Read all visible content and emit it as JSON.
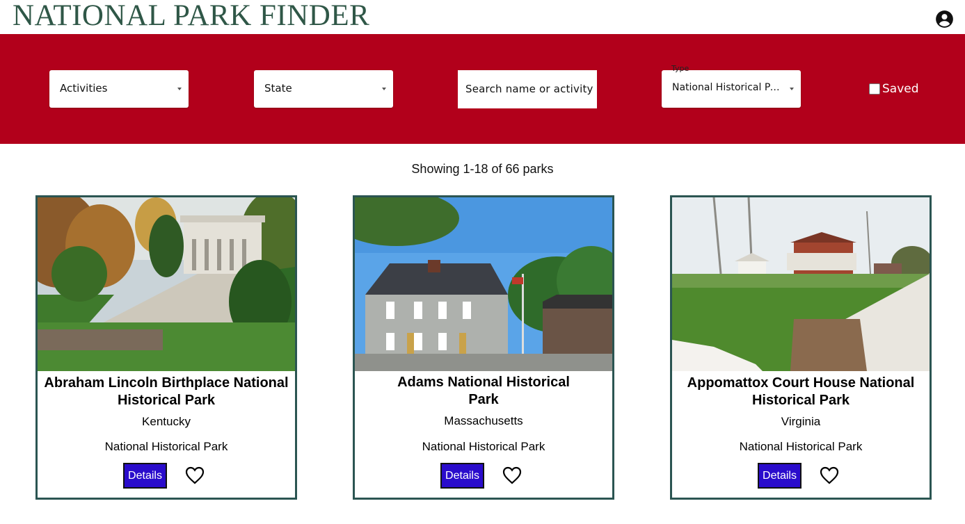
{
  "header": {
    "title": "NATIONAL PARK FINDER"
  },
  "filters": {
    "activities_label": "Activities",
    "state_label": "State",
    "search_label": "Search name or activity",
    "type_floating_label": "Type",
    "type_value": "National Historical Park",
    "saved_label": "Saved",
    "saved_checked": false
  },
  "colors": {
    "brand_green": "#2f5747",
    "filter_band": "#b2001b",
    "details_button": "#2a0ccc",
    "card_border": "#2b5552"
  },
  "results": {
    "summary": "Showing 1-18 of 66 parks"
  },
  "parks": [
    {
      "name": "Abraham Lincoln Birthplace National Historical Park",
      "state": "Kentucky",
      "type": "National Historical Park",
      "details_label": "Details",
      "saved": false
    },
    {
      "name": "Adams National Historical Park",
      "state": "Massachusetts",
      "type": "National Historical Park",
      "details_label": "Details",
      "saved": false
    },
    {
      "name": "Appomattox Court House National Historical Park",
      "state": "Virginia",
      "type": "National Historical Park",
      "details_label": "Details",
      "saved": false
    }
  ]
}
